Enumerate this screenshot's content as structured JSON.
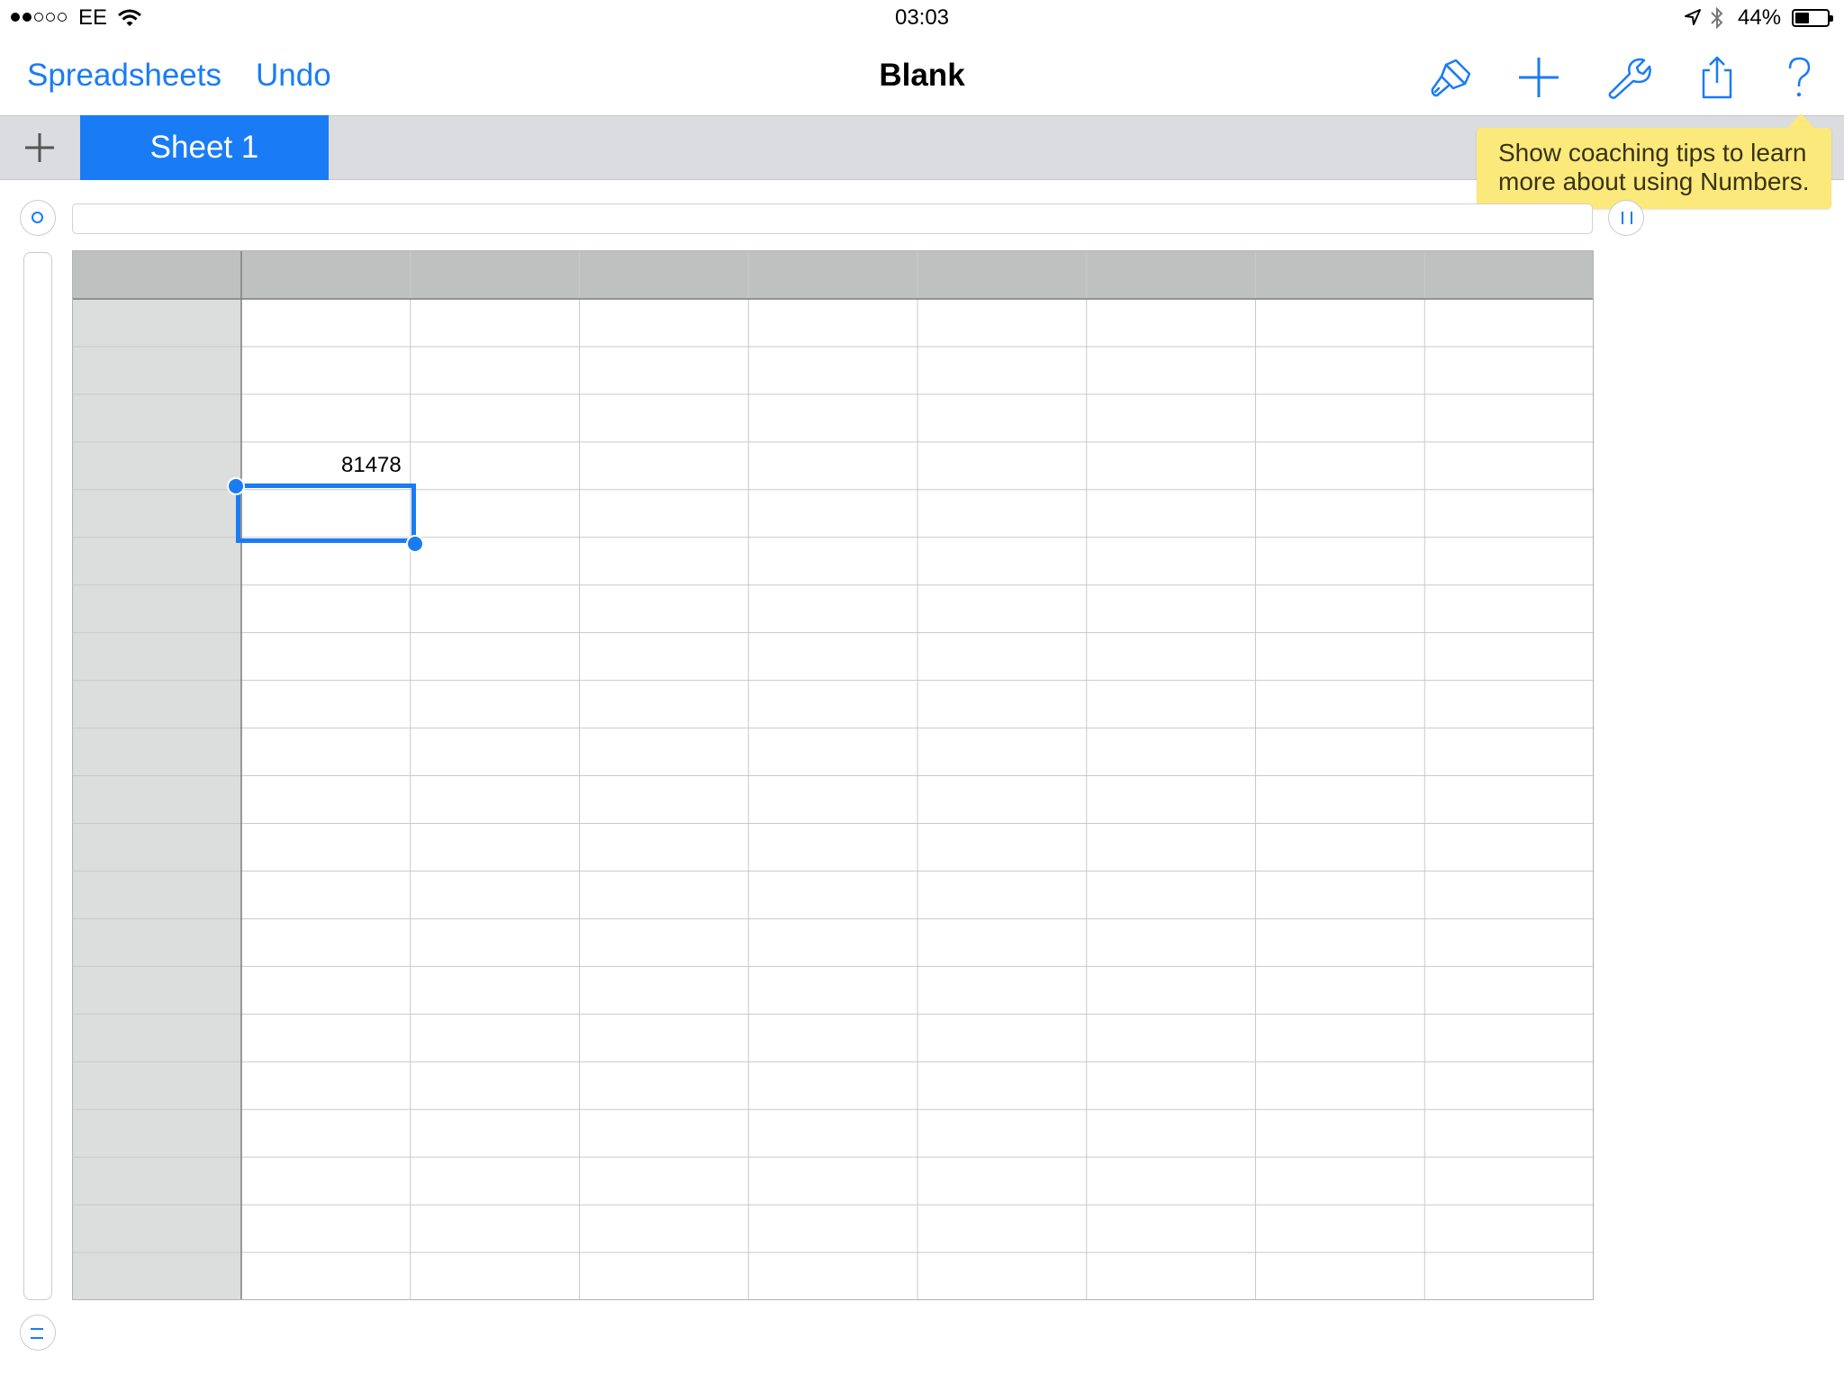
{
  "status_bar": {
    "carrier": "EE",
    "time": "03:03",
    "battery_percent": "44%",
    "signal_bars_filled": 2,
    "signal_bars_total": 5,
    "battery_level": 0.44
  },
  "toolbar": {
    "back_label": "Spreadsheets",
    "undo_label": "Undo",
    "title": "Blank",
    "icons": [
      "paintbrush-icon",
      "plus-icon",
      "wrench-icon",
      "share-icon",
      "help-icon"
    ]
  },
  "tabs": {
    "add_icon": "plus-icon",
    "items": [
      {
        "label": "Sheet 1",
        "active": true
      }
    ]
  },
  "tooltip": {
    "line1": "Show coaching tips to learn",
    "line2": "more about using Numbers."
  },
  "table": {
    "body_columns": 8,
    "body_rows": 21,
    "header_row_color": "#bfc1c0",
    "header_column_color": "#dcdddd",
    "cells": [
      {
        "row": 4,
        "col": 1,
        "value": "81478"
      }
    ],
    "selected_cell": {
      "row": 5,
      "col": 1
    }
  },
  "colors": {
    "accent": "#1a7cf5",
    "tooltip": "#fbe97c",
    "tabbar": "#dadcdf"
  }
}
